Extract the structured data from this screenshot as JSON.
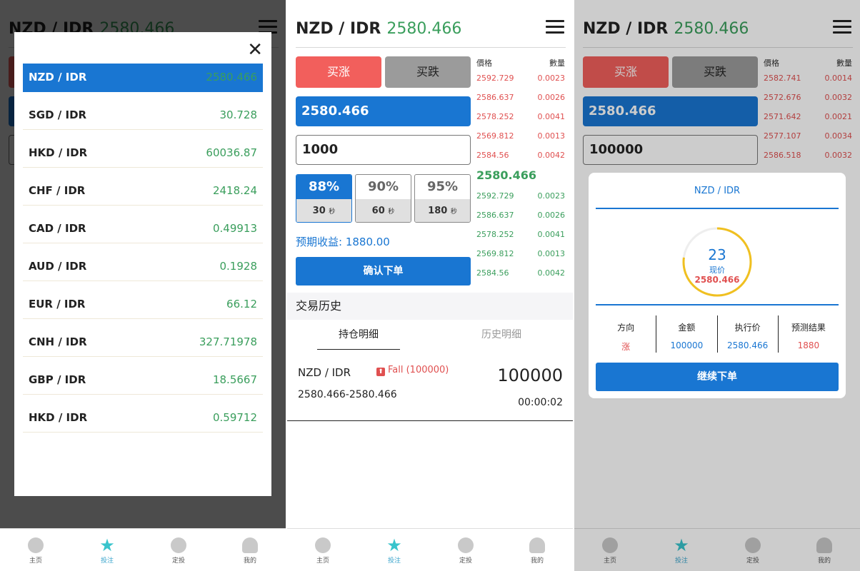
{
  "header": {
    "pair": "NZD / IDR",
    "price": "2580.466",
    "price3": "2580.466"
  },
  "trade": {
    "up_label": "买涨",
    "down_label": "买跌",
    "current_price": "2580.466",
    "amount": "1000",
    "amount3": "100000",
    "options": [
      {
        "pct": "88%",
        "time": "30",
        "unit": "秒"
      },
      {
        "pct": "90%",
        "time": "60",
        "unit": "秒"
      },
      {
        "pct": "95%",
        "time": "180",
        "unit": "秒"
      }
    ],
    "expected": "预期收益: 1880.00",
    "confirm_label": "确认下单"
  },
  "orderbook": {
    "price_header": "價格",
    "qty_header": "數量",
    "asks": [
      {
        "p": "2592.729",
        "q": "0.0023"
      },
      {
        "p": "2586.637",
        "q": "0.0026"
      },
      {
        "p": "2578.252",
        "q": "0.0041"
      },
      {
        "p": "2569.812",
        "q": "0.0013"
      },
      {
        "p": "2584.56",
        "q": "0.0042"
      }
    ],
    "mid": "2580.466",
    "bids": [
      {
        "p": "2592.729",
        "q": "0.0023"
      },
      {
        "p": "2586.637",
        "q": "0.0026"
      },
      {
        "p": "2578.252",
        "q": "0.0041"
      },
      {
        "p": "2569.812",
        "q": "0.0013"
      },
      {
        "p": "2584.56",
        "q": "0.0042"
      }
    ],
    "asks3": [
      {
        "p": "2582.741",
        "q": "0.0014"
      },
      {
        "p": "2572.676",
        "q": "0.0032"
      },
      {
        "p": "2571.642",
        "q": "0.0021"
      },
      {
        "p": "2577.107",
        "q": "0.0034"
      },
      {
        "p": "2586.518",
        "q": "0.0032"
      }
    ]
  },
  "history": {
    "title": "交易历史",
    "tab_open": "持仓明细",
    "tab_past": "历史明细",
    "position": {
      "pair": "NZD / IDR",
      "direction": "Fall (100000)",
      "amount": "100000",
      "range": "2580.466-2580.466",
      "time": "00:00:02"
    }
  },
  "nav": [
    {
      "label": "主页",
      "icon": "home-icon"
    },
    {
      "label": "投注",
      "icon": "star-icon"
    },
    {
      "label": "定投",
      "icon": "eye-icon"
    },
    {
      "label": "我的",
      "icon": "user-icon"
    }
  ],
  "pair_list": [
    {
      "name": "NZD / IDR",
      "price": "2580.466"
    },
    {
      "name": "SGD / IDR",
      "price": "30.728"
    },
    {
      "name": "HKD / IDR",
      "price": "60036.87"
    },
    {
      "name": "CHF / IDR",
      "price": "2418.24"
    },
    {
      "name": "CAD / IDR",
      "price": "0.49913"
    },
    {
      "name": "AUD / IDR",
      "price": "0.1928"
    },
    {
      "name": "EUR / IDR",
      "price": "66.12"
    },
    {
      "name": "CNH / IDR",
      "price": "327.71978"
    },
    {
      "name": "GBP / IDR",
      "price": "18.5667"
    },
    {
      "name": "HKD / IDR",
      "price": "0.59712"
    }
  ],
  "result": {
    "title": "NZD / IDR",
    "countdown": "23",
    "now_label": "现价",
    "now_price": "2580.466",
    "countdown_progress": 0.77,
    "col_labels": [
      "方向",
      "金额",
      "执行价",
      "预测结果"
    ],
    "col_values": [
      "涨",
      "100000",
      "2580.466",
      "1880"
    ],
    "continue_label": "继续下单",
    "colors": {
      "up": "#e05050",
      "blue": "#1976d2",
      "ring": "#f0c020"
    }
  }
}
